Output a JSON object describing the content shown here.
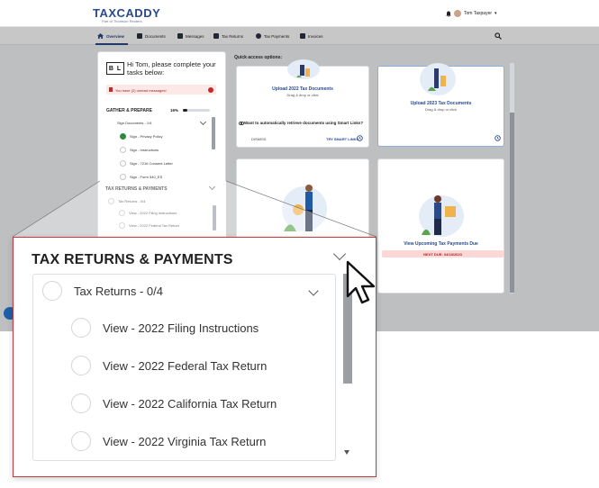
{
  "app": {
    "logo": "TAXCADDY",
    "logo_sub": "Part of Thomson Reuters",
    "user_name": "Tom Taxpayer"
  },
  "nav": {
    "items": [
      "Overview",
      "Documents",
      "Messages",
      "Tax Returns",
      "Tax Payments",
      "Invoices"
    ],
    "active": "Overview"
  },
  "left_panel": {
    "initials": "B L",
    "greeting": "Hi Tom, please complete your tasks below:",
    "alert": "You have (2) unread messages!",
    "gather_title": "GATHER & PREPARE",
    "gather_progress": "16%",
    "gather_progress_value": 0.16,
    "sign_group": "Sign Documents - 1/4",
    "sign_items": [
      {
        "label": "Sign - Privacy Policy",
        "done": true
      },
      {
        "label": "Sign - Instructions",
        "done": false
      },
      {
        "label": "Sign - 7216 Consent Letter",
        "done": false
      },
      {
        "label": "Sign - Form 540_ES",
        "done": false
      }
    ],
    "returns_title": "TAX RETURNS & PAYMENTS",
    "returns_group": "Tax Returns - 0/4",
    "returns_items": [
      "View - 2022 Filing Instructions",
      "View - 2022 Federal Tax Return"
    ]
  },
  "quick_access": {
    "title": "Quick access options:",
    "upload_2022_title": "Upload 2022 Tax Documents",
    "upload_2022_sub": "Drag & drop or click",
    "upload_2023_title": "Upload 2023 Tax Documents",
    "upload_2023_sub": "Drag & drop or click",
    "smart_links_q": "Want to automatically retrieve documents using Smart Links?",
    "dismiss": "DISMISS",
    "try_smart": "TRY SMART LINKS",
    "payments_title": "View Upcoming Tax Payments Due",
    "next_due": "NEXT DUE: 04/18/2023"
  },
  "zoom_panel": {
    "title": "TAX RETURNS & PAYMENTS",
    "group_label": "Tax Returns - 0/4",
    "items": [
      "View - 2022 Filing Instructions",
      "View - 2022 Federal Tax Return",
      "View - 2022 California Tax Return",
      "View - 2022 Virginia Tax Return"
    ]
  },
  "colors": {
    "brand": "#2a4a8a",
    "callout_border": "#c43a3f",
    "done_green": "#2e8b3d",
    "alert_red": "#c62828"
  }
}
